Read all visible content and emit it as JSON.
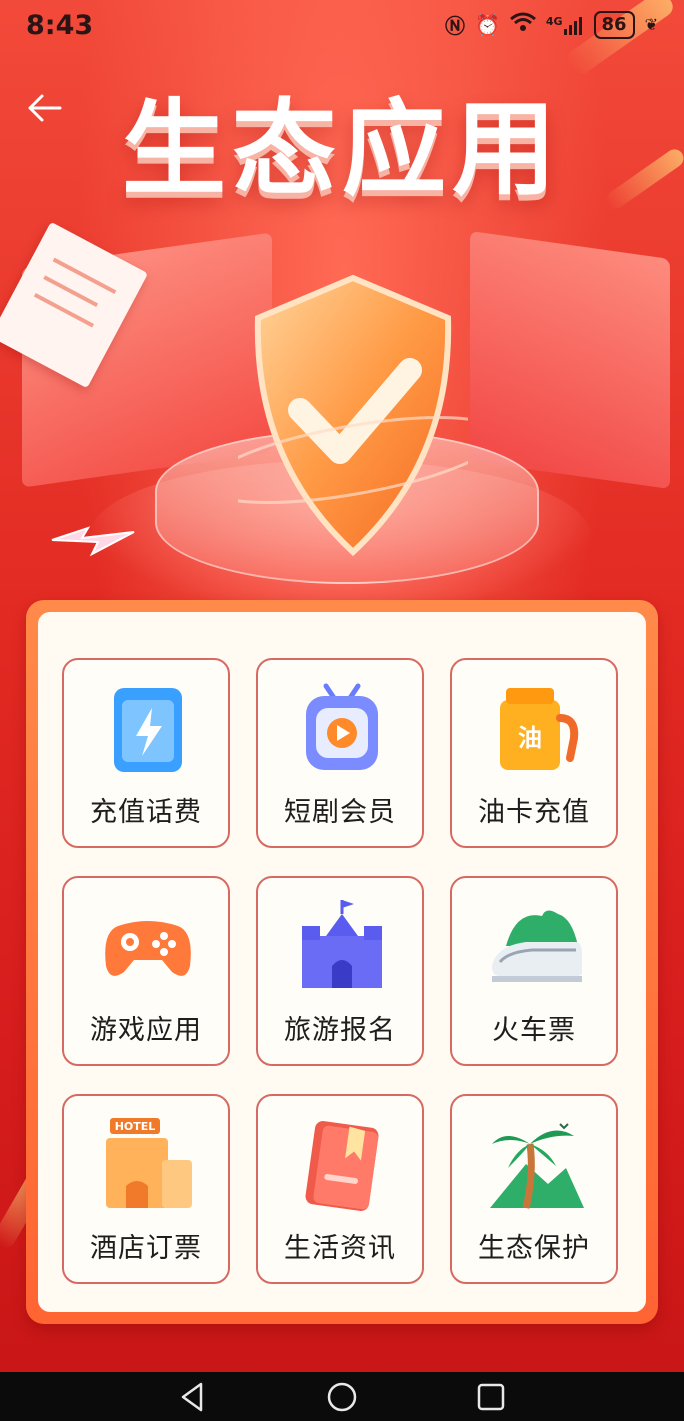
{
  "status_bar": {
    "time": "8:43",
    "network": "4G",
    "battery": "86",
    "icons": [
      "nfc-icon",
      "alarm-icon",
      "wifi-icon",
      "signal-icon",
      "battery-icon",
      "leaf-icon"
    ]
  },
  "header": {
    "back_icon": "back-arrow-icon",
    "title": "生态应用"
  },
  "apps": [
    {
      "label": "充值话费",
      "icon": "phone-recharge-icon",
      "color": "#3aa0ff"
    },
    {
      "label": "短剧会员",
      "icon": "tv-play-icon",
      "color": "#6a7bff"
    },
    {
      "label": "油卡充值",
      "icon": "fuel-can-icon",
      "color": "#ffb020"
    },
    {
      "label": "游戏应用",
      "icon": "gamepad-icon",
      "color": "#ff7a3a"
    },
    {
      "label": "旅游报名",
      "icon": "castle-icon",
      "color": "#5a5cf0"
    },
    {
      "label": "火车票",
      "icon": "train-icon",
      "color": "#34b26a"
    },
    {
      "label": "酒店订票",
      "icon": "hotel-icon",
      "color": "#ffa44a"
    },
    {
      "label": "生活资讯",
      "icon": "book-icon",
      "color": "#f05a4a"
    },
    {
      "label": "生态保护",
      "icon": "palm-tree-icon",
      "color": "#2fae6a"
    }
  ],
  "hotel_sign": "HOTEL",
  "fuel_char": "油",
  "nav_bar": {
    "buttons": [
      "back-triangle-icon",
      "home-circle-icon",
      "recents-square-icon"
    ]
  }
}
